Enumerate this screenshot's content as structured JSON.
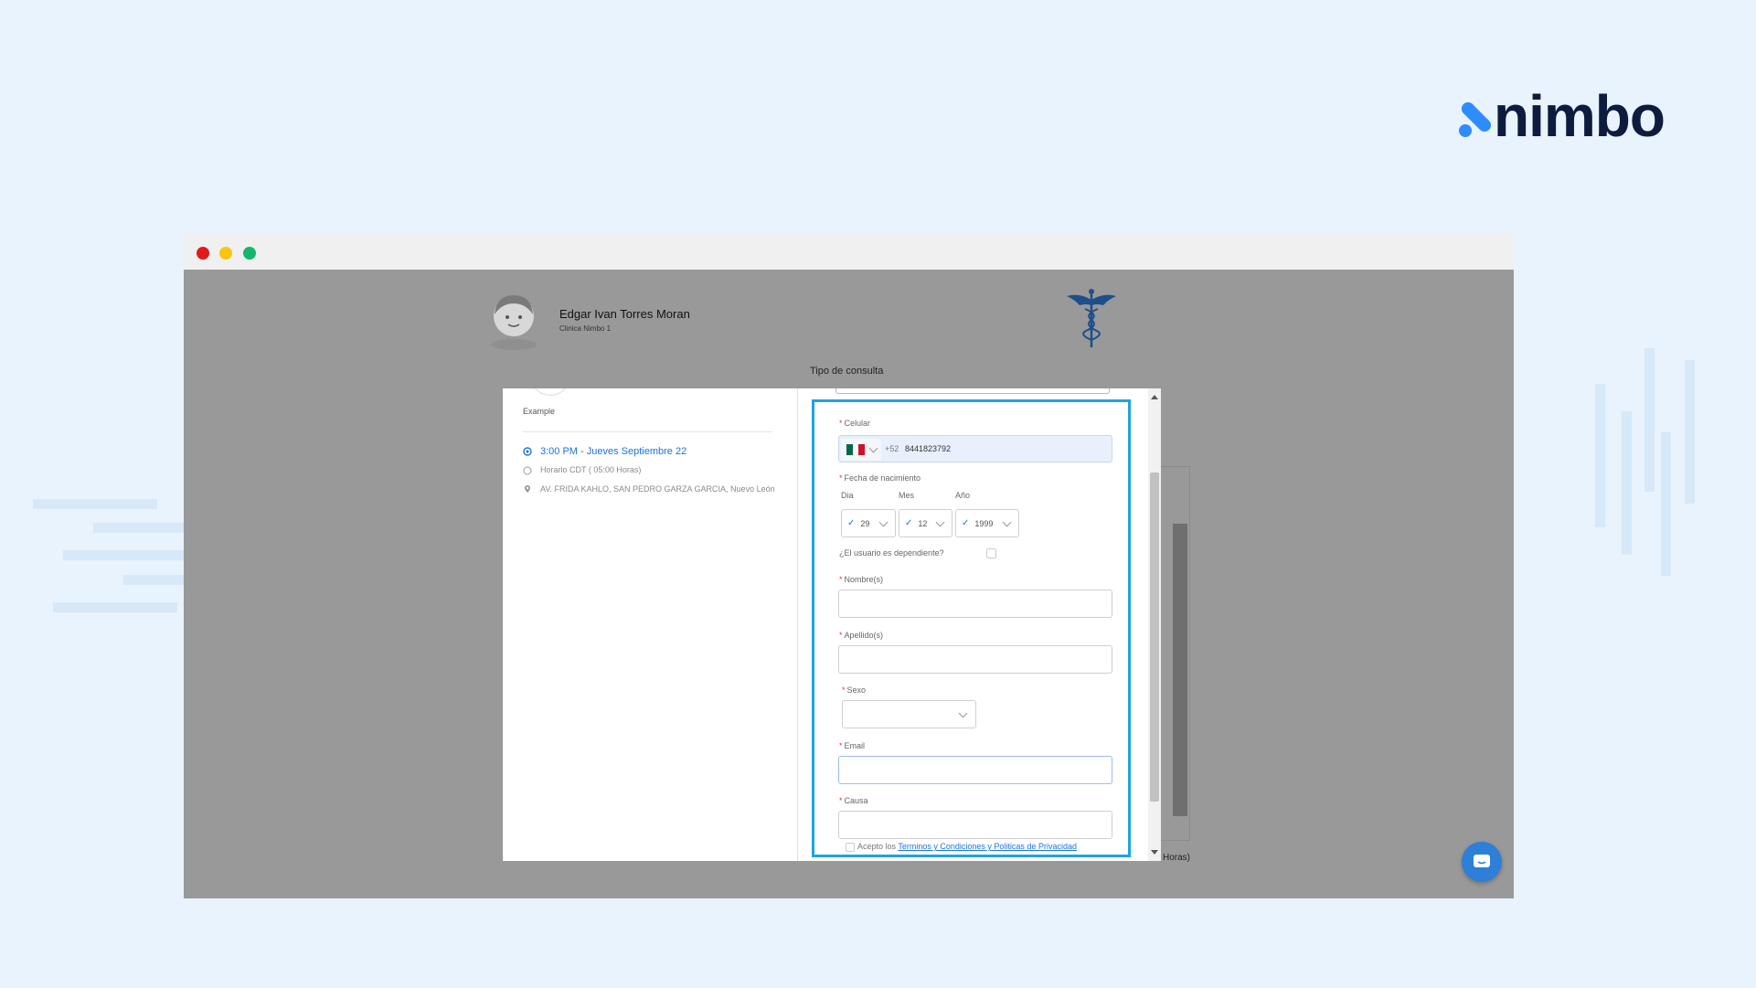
{
  "brand": {
    "name": "nimbo"
  },
  "window": {
    "controls": [
      "close",
      "minimize",
      "maximize"
    ]
  },
  "doctor": {
    "name": "Edgar Ivan Torres Moran",
    "clinic": "Clinica Nimbo 1"
  },
  "background": {
    "tipo_consulta": "Tipo de consulta",
    "horas_fragment": "Horas)"
  },
  "appointment": {
    "patient_example": "Example",
    "time": "3:00 PM - Jueves Septiembre 22",
    "timezone": "Horario CDT ( 05:00 Horas)",
    "address": "AV. FRIDA KAHLO, SAN PEDRO GARZA GARCIA, Nuevo León"
  },
  "form": {
    "required_mark": "*",
    "celular_label": "Celular",
    "phone_code": "+52",
    "phone_number": "8441823792",
    "birth_label": "Fecha de nacimiento",
    "dia_label": "Dia",
    "mes_label": "Mes",
    "anio_label": "Año",
    "dia_value": "29",
    "mes_value": "12",
    "anio_value": "1999",
    "dependent_label": "¿El usuario es dependiente?",
    "nombre_label": "Nombre(s)",
    "apellido_label": "Apellido(s)",
    "sexo_label": "Sexo",
    "email_label": "Email",
    "causa_label": "Causa",
    "terms_prefix": "Acepto los",
    "terms_link": "Terminos y Condiciones y Politicas de Privacidad"
  },
  "colors": {
    "page_bg": "#e8f3fd",
    "brand_dark": "#0d1b3e",
    "brand_blue": "#1a73e8",
    "highlight": "#1fa3e0",
    "close": "#e5191d",
    "minimize": "#f6c611",
    "maximize": "#12b76a"
  },
  "icons": [
    "nimbo-logo-icon",
    "caduceus-icon",
    "clock-icon",
    "globe-icon",
    "location-pin-icon",
    "mexico-flag-icon",
    "chevron-down-icon",
    "check-icon",
    "chat-icon"
  ]
}
